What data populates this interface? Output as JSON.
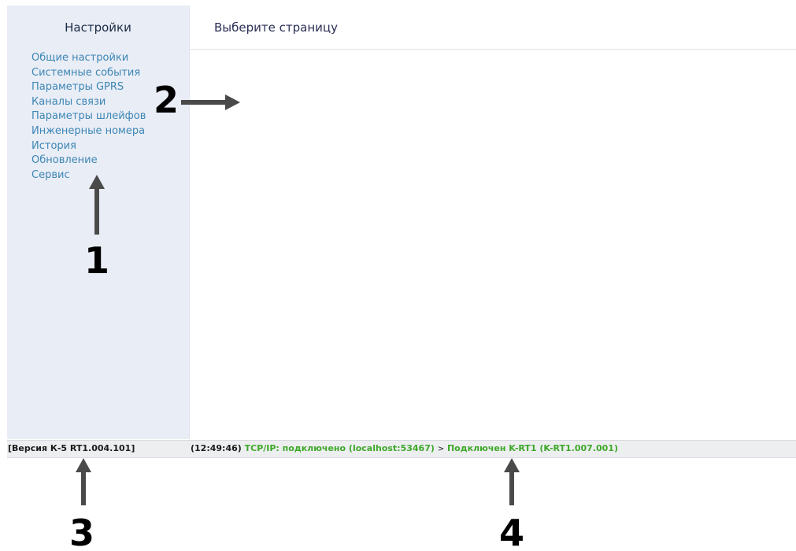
{
  "sidebar": {
    "title": "Настройки",
    "items": [
      {
        "label": "Общие настройки"
      },
      {
        "label": "Системные события"
      },
      {
        "label": "Параметры GPRS"
      },
      {
        "label": "Каналы связи"
      },
      {
        "label": "Параметры шлейфов"
      },
      {
        "label": "Инженерные номера"
      },
      {
        "label": "История"
      },
      {
        "label": "Обновление"
      },
      {
        "label": "Сервис"
      }
    ]
  },
  "main": {
    "title": "Выберите страницу"
  },
  "statusbar": {
    "version": "[Версия К-5 RT1.004.101]",
    "time": "(12:49:46)",
    "tcp_status": "TCP/IP: подключено (localhost:53467)",
    "separator": ">",
    "device_status": "Подключен K-RT1 (K-RT1.007.001)"
  },
  "annotations": {
    "labels": [
      "1",
      "2",
      "3",
      "4"
    ]
  },
  "colors": {
    "sidebar_bg": "#e9edf6",
    "link": "#3d86b4",
    "status_ok": "#3ea82a",
    "statusbar_bg": "#edeef0"
  }
}
